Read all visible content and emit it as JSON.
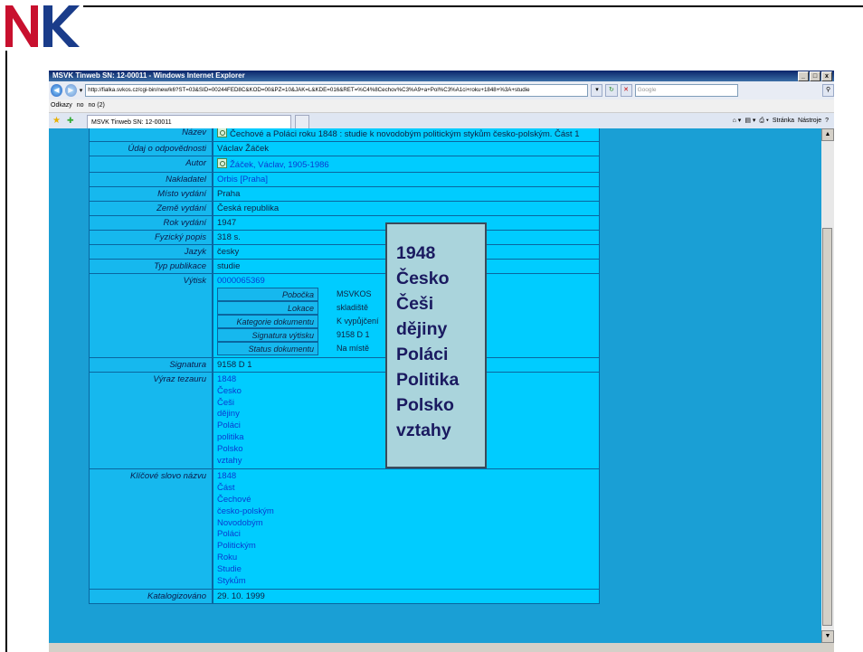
{
  "window": {
    "title": "MSVK Tinweb SN: 12-00011 - Windows Internet Explorer",
    "controls": [
      "_",
      "□",
      "x"
    ]
  },
  "address": {
    "url": "http://fialka.svkos.cz/cgi-bin/new/k6?ST=03&SID=00244FED8C&KOD=00&PZ=10&JAK=L&KDE=016&RET=%C4%8Cechov%C3%A9+a+Pol%C3%A1ci+roku+1848+%3A+studie",
    "search_placeholder": "Google"
  },
  "links": {
    "label": "Odkazy",
    "items": [
      "no",
      "no (2)"
    ]
  },
  "tab": {
    "title": "MSVK Tinweb SN: 12-00011"
  },
  "commandbar": {
    "items": [
      "Stránka",
      "Nástroje"
    ]
  },
  "record": [
    {
      "label": "Název",
      "value": "Čechové a Poláci roku 1848 : studie k novodobým politickým stykům česko-polským. Část 1",
      "icon": true,
      "link": false
    },
    {
      "label": "Údaj o odpovědnosti",
      "value": "Václav Žáček",
      "icon": false,
      "link": false
    },
    {
      "label": "Autor",
      "value": "Žáček, Václav, 1905-1986",
      "icon": true,
      "link": true
    },
    {
      "label": "Nakladatel",
      "value": "Orbis [Praha]",
      "icon": false,
      "link": true
    },
    {
      "label": "Místo vydání",
      "value": "Praha",
      "icon": false,
      "link": false
    },
    {
      "label": "Země vydání",
      "value": "Česká republika",
      "icon": false,
      "link": false
    },
    {
      "label": "Rok vydání",
      "value": "1947",
      "icon": false,
      "link": false
    },
    {
      "label": "Fyzický popis",
      "value": "318 s.",
      "icon": false,
      "link": false
    },
    {
      "label": "Jazyk",
      "value": "česky",
      "icon": false,
      "link": false
    },
    {
      "label": "Typ publikace",
      "value": "studie",
      "icon": false,
      "link": false
    }
  ],
  "vytisk": {
    "label": "Výtisk",
    "barcode": "0000065369",
    "fields": [
      {
        "label": "Pobočka",
        "value": "MSVKOS"
      },
      {
        "label": "Lokace",
        "value": "skladiště"
      },
      {
        "label": "Kategorie dokumentu",
        "value": "K vypůjčení"
      },
      {
        "label": "Signatura výtisku",
        "value": "9158 D 1"
      },
      {
        "label": "Status dokumentu",
        "value": "Na místě"
      }
    ]
  },
  "signatura": {
    "label": "Signatura",
    "value": "9158 D 1"
  },
  "tezaurus": {
    "label": "Výraz tezauru",
    "items": [
      "1848",
      "Česko",
      "Češi",
      "dějiny",
      "Poláci",
      "politika",
      "Polsko",
      "vztahy"
    ]
  },
  "klicova": {
    "label": "Klíčové slovo názvu",
    "items": [
      "1848",
      "Část",
      "Čechové",
      "česko-polským",
      "Novodobým",
      "Poláci",
      "Politickým",
      "Roku",
      "Studie",
      "Stykům"
    ]
  },
  "katalog": {
    "label": "Katalogizováno",
    "value": "29. 10. 1999"
  },
  "overlay": {
    "items": [
      "1948",
      "Česko",
      "Češi",
      "dějiny",
      "Poláci",
      "Politika",
      "Polsko",
      "vztahy"
    ]
  }
}
